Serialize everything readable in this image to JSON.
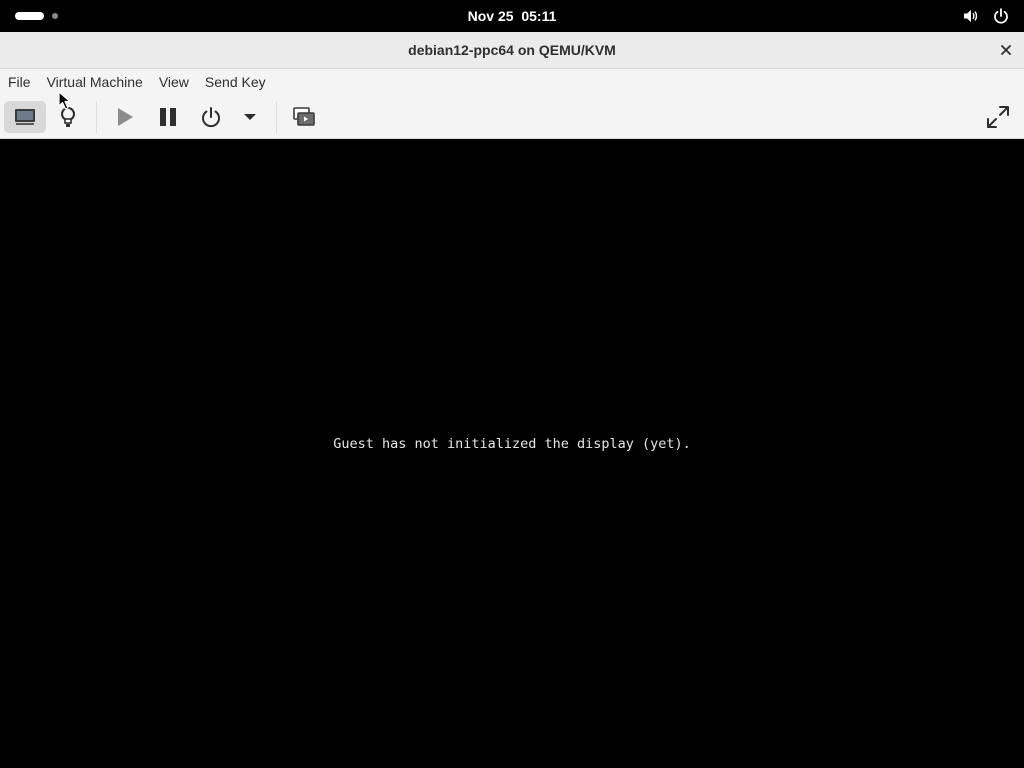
{
  "topbar": {
    "date": "Nov 25",
    "time": "05:11",
    "icons": [
      "volume-icon",
      "power-icon"
    ]
  },
  "window": {
    "title": "debian12-ppc64 on QEMU/KVM"
  },
  "menubar": {
    "items": [
      "File",
      "Virtual Machine",
      "View",
      "Send Key"
    ]
  },
  "toolbar": {
    "buttons": [
      {
        "icon": "console-display-icon",
        "active": true
      },
      {
        "icon": "lightbulb-details-icon"
      },
      {
        "icon": "run-icon"
      },
      {
        "icon": "pause-icon"
      },
      {
        "icon": "shutdown-icon"
      },
      {
        "icon": "dropdown-arrow-icon"
      },
      {
        "icon": "snapshots-icon"
      },
      {
        "icon": "fullscreen-icon"
      }
    ]
  },
  "console": {
    "message": "Guest has not initialized the display (yet)."
  }
}
